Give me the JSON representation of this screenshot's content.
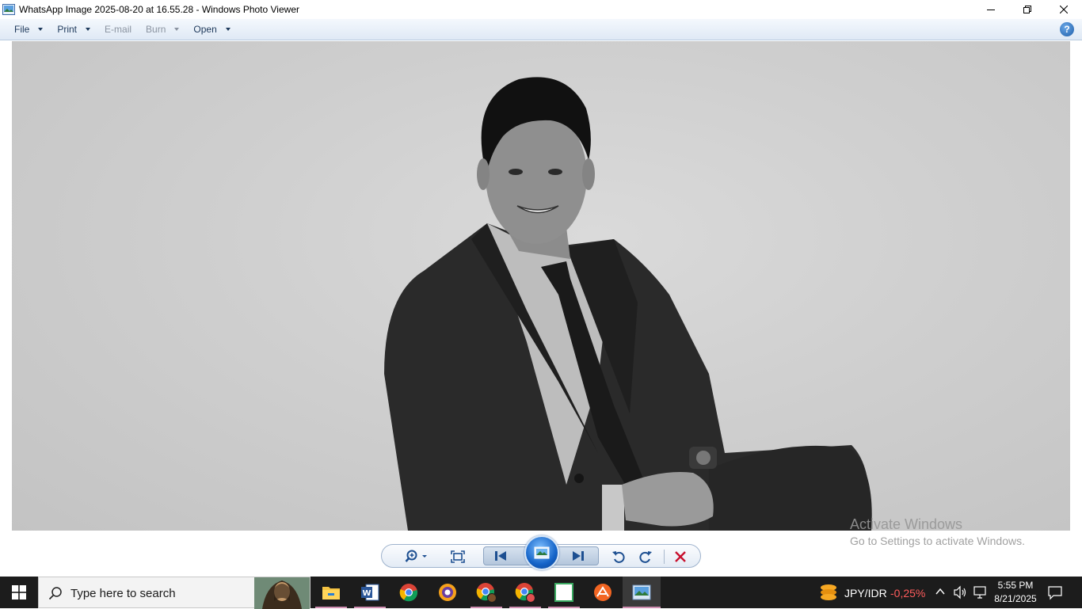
{
  "window": {
    "title": "WhatsApp Image 2025-08-20 at 16.55.28 - Windows Photo Viewer",
    "controls": {
      "minimize_icon": "minimize-icon",
      "restore_icon": "restore-icon",
      "close_icon": "close-icon"
    }
  },
  "menubar": {
    "items": [
      {
        "label": "File",
        "enabled": true
      },
      {
        "label": "Print",
        "enabled": true
      },
      {
        "label": "E-mail",
        "enabled": false
      },
      {
        "label": "Burn",
        "enabled": false
      },
      {
        "label": "Open",
        "enabled": true
      }
    ],
    "help_label": "?"
  },
  "viewer": {
    "image_description_icon": "photo-portrait-man-in-suit"
  },
  "watermark": {
    "line1": "Activate Windows",
    "line2": "Go to Settings to activate Windows."
  },
  "controlbar": {
    "buttons": [
      "zoom-icon",
      "actual-size-icon",
      "previous-icon",
      "slideshow-icon",
      "next-icon",
      "rotate-left-icon",
      "rotate-right-icon",
      "delete-icon"
    ]
  },
  "taskbar": {
    "search_placeholder": "Type here to search",
    "apps": [
      "file-explorer-icon",
      "word-icon",
      "chrome-icon",
      "browser-icon",
      "chrome-profile-icon",
      "chrome-profile-2-icon",
      "blank-app-icon",
      "app-orange-icon",
      "photo-viewer-icon"
    ],
    "ticker": {
      "name": "JPY/IDR",
      "value": "-0,25%"
    },
    "clock": {
      "time": "5:55 PM",
      "date": "8/21/2025"
    }
  },
  "colors": {
    "menu_text": "#1e395b",
    "taskbar_bg": "#1c1c1c",
    "ticker_negative": "#ff5c5c"
  }
}
